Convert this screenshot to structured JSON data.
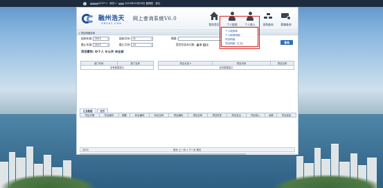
{
  "topbar": {
    "user_suffix": "309**",
    "menu_label": "我的",
    "date_text": "2023年10月26日 星期四",
    "logout_label": "退出"
  },
  "header": {
    "logo_cn": "融州浩天",
    "logo_en": "GREAT-CHN",
    "system_title": "网上查询系统V6.0",
    "nav": [
      {
        "label": "我的首页",
        "icon": "house-icon"
      },
      {
        "label": "个人报销",
        "icon": "person-icon"
      },
      {
        "label": "个人收入",
        "icon": "person-income-icon"
      },
      {
        "label": "采购查询",
        "icon": "boxes-icon"
      },
      {
        "label": "薪酬查询",
        "icon": "cash-icon"
      }
    ]
  },
  "section_title": "项目明细查询",
  "form": {
    "start_year_label": "起始年度:",
    "start_year_value": "2023",
    "start_month_label": "起始月份:",
    "start_month_value": "01",
    "end_year_label": "截止年度:",
    "end_year_value": "2023",
    "end_month_label": "截止月份:",
    "end_month_value": "10",
    "summary_label": "摘要:",
    "summary_value": "",
    "include_unposted_label": "是否包含未记账:",
    "radio_yes": "是",
    "radio_no": "否",
    "query_button": "查询"
  },
  "project_attr": {
    "label": "项目属性:",
    "options": [
      "个人",
      "公共",
      "全部"
    ],
    "selected": "全部"
  },
  "dept_table": {
    "headers": [
      "部门代码",
      "部门名称"
    ],
    "empty_text": "没有数据显示"
  },
  "project_table": {
    "headers": [
      "项目大类",
      "项目代码",
      "项目名称"
    ],
    "empty_text": "没有数据显示"
  },
  "mid_tabs": [
    "汇总数据",
    "图表"
  ],
  "detail_table": {
    "headers": [
      "凭证日期",
      "凭证编号",
      "摘要",
      "科目编码",
      "科目名称",
      "项目编码",
      "项目名称",
      "项目性质",
      "项目支出",
      "项目收入",
      "余额",
      "凭证信息"
    ]
  },
  "footer": {
    "total_label": "共0行",
    "pager_text": "首页 上一页 1 下一页 尾页"
  },
  "dropdown": {
    "items": [
      "个人报销单",
      "个人报销明细",
      "项目明细",
      "项目明细（汇总）"
    ]
  },
  "colors": {
    "accent": "#2e6fb8",
    "highlight": "#e0231b",
    "topbar": "#1f2c3d"
  }
}
